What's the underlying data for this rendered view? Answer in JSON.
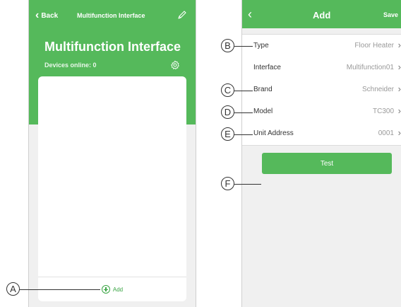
{
  "left_screen": {
    "back_label": "Back",
    "nav_title": "Multifunction Interface",
    "big_title": "Multifunction Interface",
    "devices_online": "Devices online: 0",
    "add_label": "Add"
  },
  "right_screen": {
    "title": "Add",
    "save_label": "Save",
    "rows": [
      {
        "label": "Type",
        "value": "Floor Heater"
      },
      {
        "label": "Interface",
        "value": "Multifunction01"
      },
      {
        "label": "Brand",
        "value": "Schneider"
      },
      {
        "label": "Model",
        "value": "TC300"
      },
      {
        "label": "Unit Address",
        "value": "0001"
      }
    ],
    "test_label": "Test"
  },
  "callouts": {
    "a": "A",
    "b": "B",
    "c": "C",
    "d": "D",
    "e": "E",
    "f": "F"
  },
  "colors": {
    "accent_green": "#55b95b",
    "add_green": "#3aa544"
  },
  "icons": {
    "back": "chevron-left-icon",
    "edit": "pencil-icon",
    "settings": "gear-icon",
    "add": "plus-circle-icon",
    "row_arrow": "chevron-right-icon"
  }
}
